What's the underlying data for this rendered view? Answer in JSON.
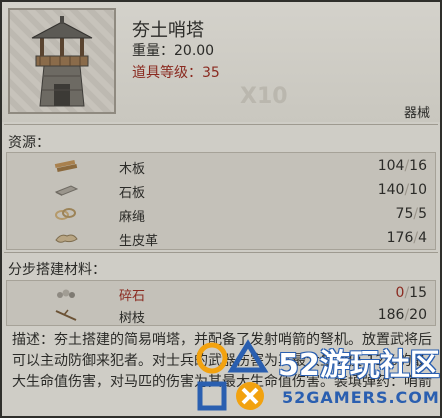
{
  "item": {
    "title": "夯土哨塔",
    "weight": "重量：20.00",
    "level": "道具等级：35",
    "bg_text": "X10",
    "category": "器械"
  },
  "resources": {
    "title": "资源：",
    "rows": [
      {
        "name": "木板",
        "have": "104",
        "sep": "/",
        "need": "16",
        "icon": "wood-plank-icon"
      },
      {
        "name": "石板",
        "have": "140",
        "sep": "/",
        "need": "10",
        "icon": "stone-slab-icon"
      },
      {
        "name": "麻绳",
        "have": "75",
        "sep": "/",
        "need": "5",
        "icon": "rope-icon"
      },
      {
        "name": "生皮革",
        "have": "176",
        "sep": "/",
        "need": "4",
        "icon": "rawhide-icon"
      }
    ]
  },
  "materials": {
    "title": "分步搭建材料：",
    "rows": [
      {
        "name": "碎石",
        "have": "0",
        "sep": "/",
        "need": "15",
        "icon": "gravel-icon",
        "insufficient": true
      },
      {
        "name": "树枝",
        "have": "186",
        "sep": "/",
        "need": "20",
        "icon": "branch-icon",
        "insufficient": false
      }
    ]
  },
  "description": "描述：夯土搭建的简易哨塔，并配备了发射哨箭的弩机。放置武将后可以主动防御来犯者。对士兵的武器伤害为其最大生命值 12%的最大生命值伤害，对马匹的伤害为其最大生命值伤害。装填弹药：哨箭",
  "watermark": {
    "main": "52游玩社区",
    "url": "52GAMERS.COM"
  },
  "colors": {
    "panel_bg": "#cfcdc6",
    "text": "#2b2b28",
    "warning_red": "#8a2a20",
    "watermark_blue": "#2a5fb0",
    "watermark_orange": "#f2a20f"
  }
}
